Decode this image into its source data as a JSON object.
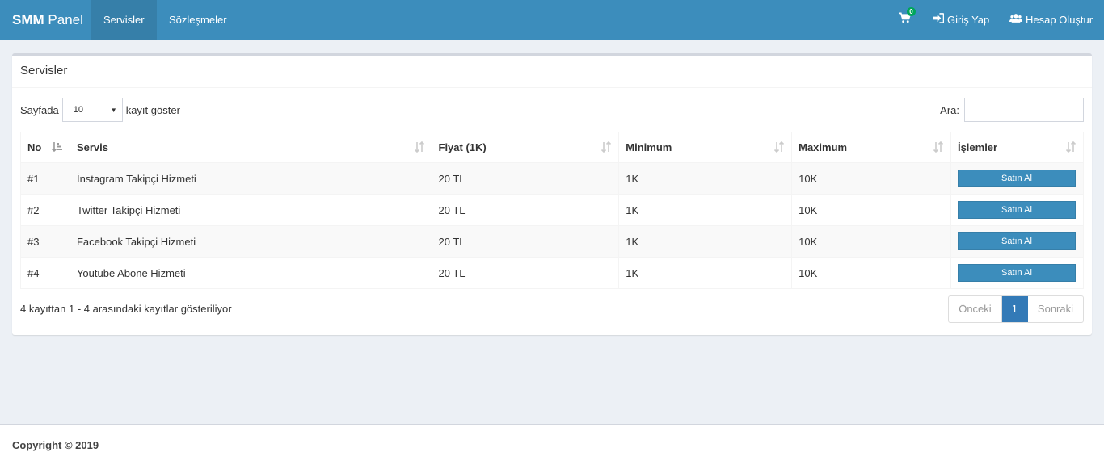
{
  "navbar": {
    "brand_bold": "SMM",
    "brand_rest": " Panel",
    "tabs": [
      {
        "label": "Servisler",
        "active": true
      },
      {
        "label": "Sözleşmeler",
        "active": false
      }
    ],
    "cart_count": "0",
    "login_label": "Giriş Yap",
    "register_label": "Hesap Oluştur"
  },
  "box": {
    "title": "Servisler",
    "length_prefix": "Sayfada",
    "length_value": "10",
    "length_suffix": "kayıt göster",
    "search_label": "Ara:",
    "search_value": ""
  },
  "table": {
    "headers": [
      "No",
      "Servis",
      "Fiyat (1K)",
      "Minimum",
      "Maximum",
      "İşlemler"
    ],
    "rows": [
      {
        "no": "#1",
        "service": "İnstagram Takipçi Hizmeti",
        "price": "20 TL",
        "min": "1K",
        "max": "10K",
        "action": "Satın Al"
      },
      {
        "no": "#2",
        "service": "Twitter Takipçi Hizmeti",
        "price": "20 TL",
        "min": "1K",
        "max": "10K",
        "action": "Satın Al"
      },
      {
        "no": "#3",
        "service": "Facebook Takipçi Hizmeti",
        "price": "20 TL",
        "min": "1K",
        "max": "10K",
        "action": "Satın Al"
      },
      {
        "no": "#4",
        "service": "Youtube Abone Hizmeti",
        "price": "20 TL",
        "min": "1K",
        "max": "10K",
        "action": "Satın Al"
      }
    ]
  },
  "info_text": "4 kayıttan 1 - 4 arasındaki kayıtlar gösteriliyor",
  "pagination": {
    "prev": "Önceki",
    "current": "1",
    "next": "Sonraki"
  },
  "footer": {
    "copyright": "Copyright © 2019"
  },
  "colors": {
    "navbar": "#3c8dbc",
    "active_tab": "#367fa9",
    "badge": "#00a65a",
    "page_bg": "#ecf0f5",
    "pager_active": "#337ab7"
  }
}
